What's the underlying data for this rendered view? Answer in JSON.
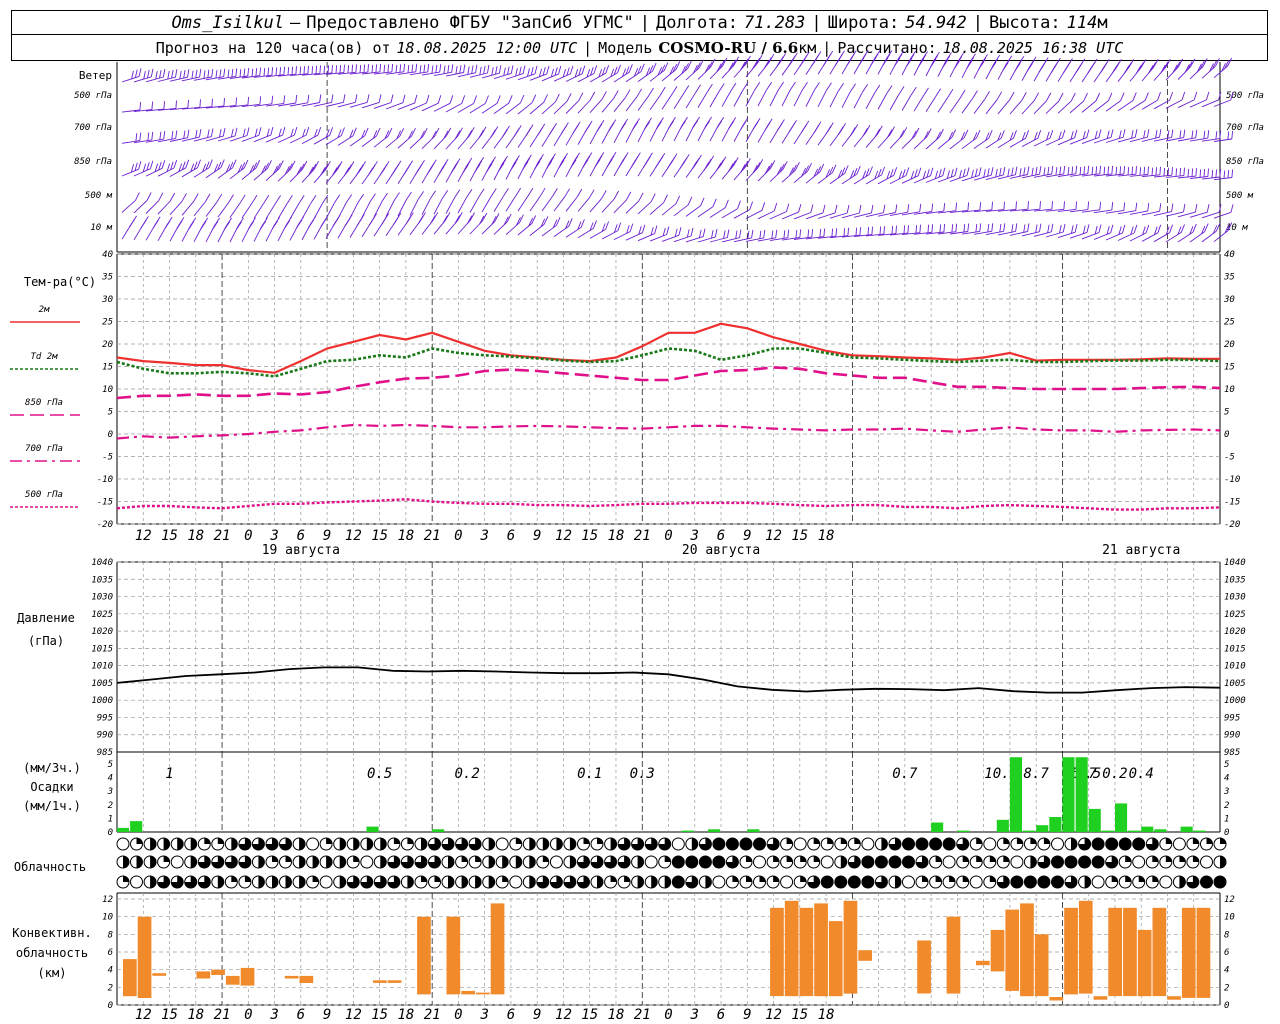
{
  "header": {
    "station": "Oms_Isilkul",
    "provided_prefix": "–",
    "provided": "Предоставлено ФГБУ \"ЗапСиб УГМС\"",
    "lon_label": "Долгота:",
    "lon_value": "71.283",
    "lat_label": "Широта:",
    "lat_value": "54.942",
    "alt_label": "Высота:",
    "alt_value": "114",
    "alt_unit": "м",
    "forecast_prefix": "Прогноз на 120 часа(ов) от",
    "forecast_time": "18.08.2025 12:00 UTC",
    "model_label": "Модель",
    "model_name": "COSMO-RU / 6.6",
    "model_unit": "км",
    "calc_label": "Рассчитано:",
    "calc_time": "18.08.2025 16:38 UTC"
  },
  "colors": {
    "wind": "#6a1fd0",
    "t2m": "#ee3030",
    "td": "#1a7a1a",
    "t_iso": "#e0108a",
    "pressure": "#000000",
    "precip": "#20d020",
    "convective": "#f08a2a",
    "grid": "#9a9a9a"
  },
  "chart_data": [
    {
      "type": "wind-barbs",
      "panel_label": "Ветер",
      "levels": [
        "500 гПа",
        "700 гПа",
        "850 гПа",
        "500 м",
        "10 м"
      ]
    },
    {
      "type": "line",
      "ylabel": "Тем-ра(°C)",
      "ylim": [
        -20,
        40
      ],
      "yticks": [
        -20,
        -15,
        -10,
        -5,
        0,
        5,
        10,
        15,
        20,
        25,
        30,
        35,
        40
      ],
      "x_ticks": [
        "12",
        "15",
        "18",
        "21",
        "0",
        "3",
        "6",
        "9",
        "12",
        "15",
        "18",
        "21",
        "0",
        "3",
        "6",
        "9",
        "12",
        "15",
        "18",
        "21",
        "0",
        "3",
        "6",
        "9",
        "12",
        "15",
        "18"
      ],
      "day_labels": [
        {
          "label": "19 августа",
          "hour": 21
        },
        {
          "label": "20 августа",
          "hour": 69
        },
        {
          "label": "21 августа",
          "hour": 117
        }
      ],
      "x_hours": [
        0,
        3,
        6,
        9,
        12,
        15,
        18,
        21,
        24,
        27,
        30,
        33,
        36,
        39,
        42,
        45,
        48,
        51,
        54,
        57,
        60,
        63,
        66,
        69,
        72,
        75,
        78,
        81,
        84,
        87,
        90,
        93,
        96,
        99,
        102,
        105,
        108,
        111,
        114,
        117,
        120,
        123,
        126
      ],
      "series": [
        {
          "name": "2м",
          "key": "t2m",
          "values": [
            17,
            16.2,
            15.8,
            15.3,
            15.3,
            14.2,
            13.6,
            16.2,
            19,
            20.5,
            22,
            21,
            22.5,
            20.5,
            18.5,
            17.5,
            17,
            16.5,
            16.2,
            17,
            19.5,
            22.5,
            22.5,
            24.5,
            23.5,
            21.5,
            20,
            18.5,
            17.5,
            17.3,
            17,
            16.8,
            16.5,
            17,
            18,
            16.3,
            16.5,
            16.5,
            16.5,
            16.6,
            16.8,
            16.7,
            16.7
          ]
        },
        {
          "name": "Td 2м",
          "key": "td",
          "values": [
            16,
            14.5,
            13.5,
            13.5,
            13.8,
            13.5,
            12.8,
            14.5,
            16.2,
            16.5,
            17.5,
            17,
            19,
            18,
            17.5,
            17.2,
            16.8,
            16.3,
            16,
            16.2,
            17.5,
            19,
            18.5,
            16.5,
            17.5,
            19,
            19,
            18,
            17,
            16.8,
            16.5,
            16.2,
            16,
            16.3,
            16.5,
            16,
            16,
            16.2,
            16.3,
            16.3,
            16.5,
            16.5,
            16.2
          ]
        },
        {
          "name": "850 гПа",
          "key": "t850",
          "values": [
            8,
            8.5,
            8.5,
            8.8,
            8.5,
            8.5,
            9,
            8.8,
            9.3,
            10.5,
            11.5,
            12.3,
            12.5,
            13,
            14,
            14.3,
            14,
            13.5,
            13,
            12.5,
            12,
            12,
            13,
            14,
            14.2,
            14.8,
            14.5,
            13.5,
            13,
            12.5,
            12.5,
            11.5,
            10.5,
            10.5,
            10.2,
            10,
            10,
            10,
            10,
            10.2,
            10.4,
            10.5,
            10.2
          ]
        },
        {
          "name": "700 гПа",
          "key": "t700",
          "values": [
            -1,
            -0.5,
            -0.8,
            -0.5,
            -0.3,
            0,
            0.5,
            0.8,
            1.5,
            2,
            1.8,
            2,
            1.8,
            1.5,
            1.5,
            1.7,
            1.8,
            1.7,
            1.5,
            1.3,
            1.2,
            1.5,
            1.8,
            1.8,
            1.5,
            1.2,
            1,
            0.8,
            1,
            1,
            1.2,
            0.8,
            0.5,
            1,
            1.5,
            1,
            0.8,
            0.8,
            0.5,
            0.8,
            0.9,
            1,
            0.8
          ]
        },
        {
          "name": "500 гПа",
          "key": "t500",
          "values": [
            -16.5,
            -16,
            -16,
            -16.3,
            -16.5,
            -16,
            -15.5,
            -15.5,
            -15.2,
            -15,
            -14.8,
            -14.5,
            -15,
            -15.3,
            -15.5,
            -15.5,
            -15.8,
            -15.8,
            -16,
            -15.8,
            -15.5,
            -15.5,
            -15.3,
            -15.3,
            -15.3,
            -15.5,
            -15.8,
            -16,
            -15.8,
            -15.8,
            -16.2,
            -16.2,
            -16.5,
            -16,
            -15.8,
            -16,
            -16.2,
            -16.5,
            -16.8,
            -16.8,
            -16.5,
            -16.5,
            -16.3
          ]
        }
      ]
    },
    {
      "type": "line",
      "ylabel": "Давление",
      "yunit": "(гПа)",
      "ylim": [
        985,
        1040
      ],
      "yticks": [
        985,
        990,
        995,
        1000,
        1005,
        1010,
        1015,
        1020,
        1025,
        1030,
        1035,
        1040
      ],
      "series": [
        {
          "name": "pressure",
          "values": [
            1005,
            1006,
            1007,
            1007.5,
            1008,
            1009,
            1009.5,
            1009.5,
            1008.5,
            1008.3,
            1008.5,
            1008.3,
            1008,
            1007.8,
            1007.8,
            1008,
            1007.5,
            1006,
            1004,
            1003,
            1002.5,
            1003,
            1003.3,
            1003.2,
            1002.9,
            1003.5,
            1002.6,
            1002.2,
            1002.2,
            1002.9,
            1003.5,
            1003.8,
            1003.6
          ]
        }
      ]
    },
    {
      "type": "bar",
      "ylabel": "(мм/3ч.)",
      "title": "Осадки",
      "yunit": "(мм/1ч.)",
      "ylim": [
        0,
        5
      ],
      "yticks": [
        0,
        1,
        2,
        3,
        4,
        5
      ],
      "totals": [
        {
          "text": "1",
          "hour": 6
        },
        {
          "text": "0.5",
          "hour": 30
        },
        {
          "text": "0.2",
          "hour": 40
        },
        {
          "text": "0.1",
          "hour": 54
        },
        {
          "text": "0.3",
          "hour": 60
        },
        {
          "text": "0.7",
          "hour": 90
        },
        {
          "text": "10.8",
          "hour": 101
        },
        {
          "text": "8.7",
          "hour": 105
        },
        {
          "text": "15.7",
          "hour": 110
        },
        {
          "text": "2.5",
          "hour": 111
        },
        {
          "text": "0.2",
          "hour": 114
        },
        {
          "text": "0.4",
          "hour": 117
        }
      ],
      "bars": [
        {
          "hour": 0,
          "value": 0.3
        },
        {
          "hour": 1,
          "value": 0.8
        },
        {
          "hour": 19,
          "value": 0.4
        },
        {
          "hour": 24,
          "value": 0.2
        },
        {
          "hour": 43,
          "value": 0.1
        },
        {
          "hour": 45,
          "value": 0.2
        },
        {
          "hour": 48,
          "value": 0.2
        },
        {
          "hour": 62,
          "value": 0.7
        },
        {
          "hour": 64,
          "value": 0.1
        },
        {
          "hour": 67,
          "value": 0.9
        },
        {
          "hour": 68,
          "value": 5.5
        },
        {
          "hour": 69,
          "value": 0.1
        },
        {
          "hour": 70,
          "value": 0.5
        },
        {
          "hour": 71,
          "value": 1.1
        },
        {
          "hour": 72,
          "value": 5.5
        },
        {
          "hour": 73,
          "value": 5.5
        },
        {
          "hour": 74,
          "value": 1.7
        },
        {
          "hour": 75,
          "value": 0.1
        },
        {
          "hour": 76,
          "value": 2.1
        },
        {
          "hour": 77,
          "value": 0.1
        },
        {
          "hour": 78,
          "value": 0.4
        },
        {
          "hour": 79,
          "value": 0.2
        },
        {
          "hour": 81,
          "value": 0.4
        },
        {
          "hour": 82,
          "value": 0.1
        }
      ]
    },
    {
      "type": "cloud-symbols",
      "label": "Облачность",
      "rows": 3
    },
    {
      "type": "bar",
      "ylabel": "Конвективн.",
      "title": "облачность",
      "yunit": "(км)",
      "ylim": [
        0,
        12
      ],
      "yticks": [
        0,
        2,
        4,
        6,
        8,
        10,
        12
      ],
      "bars": [
        {
          "hour": 0,
          "base": 1,
          "top": 5.2
        },
        {
          "hour": 1,
          "base": 0.8,
          "top": 10
        },
        {
          "hour": 2,
          "base": 3.3,
          "top": 3.6
        },
        {
          "hour": 5,
          "base": 3,
          "top": 3.8
        },
        {
          "hour": 6,
          "base": 3.4,
          "top": 4
        },
        {
          "hour": 7,
          "base": 2.3,
          "top": 3.3
        },
        {
          "hour": 8,
          "base": 2.2,
          "top": 4.2
        },
        {
          "hour": 11,
          "base": 3,
          "top": 3.3
        },
        {
          "hour": 12,
          "base": 2.5,
          "top": 3.3
        },
        {
          "hour": 17,
          "base": 2.5,
          "top": 2.8
        },
        {
          "hour": 18,
          "base": 2.5,
          "top": 2.8
        },
        {
          "hour": 20,
          "base": 1.2,
          "top": 10
        },
        {
          "hour": 22,
          "base": 1.2,
          "top": 10
        },
        {
          "hour": 23,
          "base": 1.2,
          "top": 1.6
        },
        {
          "hour": 24,
          "base": 1.2,
          "top": 1.4
        },
        {
          "hour": 25,
          "base": 1.2,
          "top": 11.5
        },
        {
          "hour": 44,
          "base": 1,
          "top": 11
        },
        {
          "hour": 45,
          "base": 1,
          "top": 11.8
        },
        {
          "hour": 46,
          "base": 1,
          "top": 11
        },
        {
          "hour": 47,
          "base": 1,
          "top": 11.5
        },
        {
          "hour": 48,
          "base": 1,
          "top": 9.5
        },
        {
          "hour": 49,
          "base": 1.3,
          "top": 11.8
        },
        {
          "hour": 50,
          "base": 5,
          "top": 6.2
        },
        {
          "hour": 54,
          "base": 1.3,
          "top": 7.3
        },
        {
          "hour": 56,
          "base": 1.3,
          "top": 10
        },
        {
          "hour": 58,
          "base": 4.5,
          "top": 5
        },
        {
          "hour": 59,
          "base": 3.8,
          "top": 8.5
        },
        {
          "hour": 60,
          "base": 1.6,
          "top": 10.8
        },
        {
          "hour": 61,
          "base": 1,
          "top": 11.5
        },
        {
          "hour": 62,
          "base": 1,
          "top": 8
        },
        {
          "hour": 63,
          "base": 0.5,
          "top": 0.9
        },
        {
          "hour": 64,
          "base": 1.2,
          "top": 11
        },
        {
          "hour": 65,
          "base": 1.3,
          "top": 11.8
        },
        {
          "hour": 66,
          "base": 0.6,
          "top": 1
        },
        {
          "hour": 67,
          "base": 1,
          "top": 11
        },
        {
          "hour": 68,
          "base": 1,
          "top": 11
        },
        {
          "hour": 69,
          "base": 1,
          "top": 8.5
        },
        {
          "hour": 70,
          "base": 1,
          "top": 11
        },
        {
          "hour": 71,
          "base": 0.6,
          "top": 1
        },
        {
          "hour": 72,
          "base": 0.8,
          "top": 11
        },
        {
          "hour": 73,
          "base": 0.8,
          "top": 11
        }
      ]
    }
  ]
}
